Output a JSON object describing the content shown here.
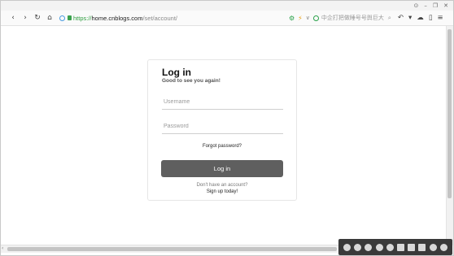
{
  "browser": {
    "window_controls": [
      "⊙",
      "–",
      "❐",
      "✕"
    ],
    "nav": {
      "back": "‹",
      "forward": "›",
      "reload": "↻",
      "home": "⌂"
    },
    "address": {
      "protocol": "https://",
      "host": "home.cnblogs.com",
      "path": "/set/account/"
    },
    "ext_icons": [
      "⚙",
      "⚡",
      "∨"
    ],
    "search": {
      "placeholder": "中企打把做睡号号舆巨大",
      "mag": "⌕"
    },
    "tools": [
      "↶",
      "▾",
      "☁",
      "▯",
      "≡"
    ]
  },
  "login": {
    "title": "Log in",
    "subtitle": "Good to see you again!",
    "username_placeholder": "Username",
    "password_placeholder": "Password",
    "forgot": "Forgot password?",
    "button": "Log in",
    "no_account": "Don't have an account?",
    "signup": "Sign up today!"
  },
  "scroll": {
    "left_arrow": "‹"
  },
  "colors": {
    "button_bg": "#5f5f5f",
    "secure_green": "#2e9e3f",
    "card_border": "#e6e6e6"
  }
}
